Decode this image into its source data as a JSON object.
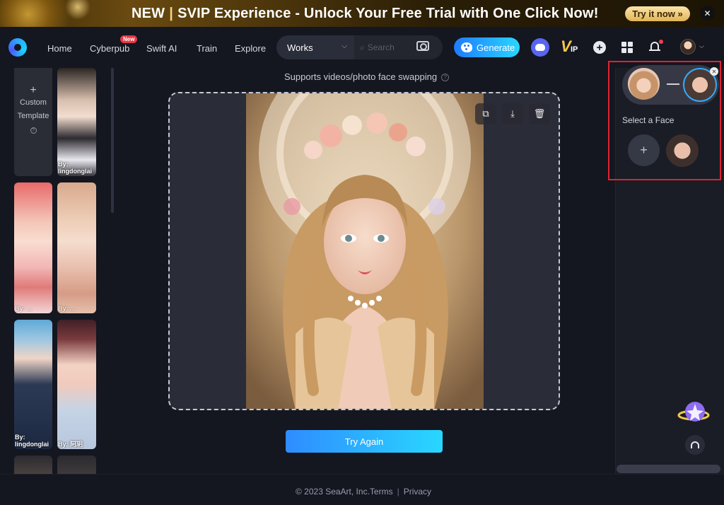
{
  "banner": {
    "new": "NEW",
    "headline": "SVIP Experience - Unlock Your Free Trial with One Click Now!",
    "cta": "Try it now",
    "cta_chevrons": "»",
    "close": "✕"
  },
  "nav": {
    "items": [
      "Home",
      "Cyberpub",
      "Swift AI",
      "Train",
      "Explore"
    ],
    "new_badge": "New",
    "works_label": "Works",
    "search_placeholder": "Search",
    "generate_label": "Generate",
    "vip_letter": "V",
    "vip_sub": "IP"
  },
  "left_panel": {
    "custom_template_line1": "Custom",
    "custom_template_line2": "Template",
    "thumbnails": [
      {
        "by": "By:\nlingdonglai"
      },
      {
        "by": "By: ..."
      },
      {
        "by": "By: ..."
      },
      {
        "by": "By:\nlingdonglai"
      },
      {
        "by": "By: 阿玥"
      }
    ]
  },
  "main": {
    "hint": "Supports videos/photo face swapping",
    "try_again": "Try Again"
  },
  "right_panel": {
    "select_face": "Select a Face"
  },
  "footer": {
    "copyright": "© 2023 SeaArt, Inc.",
    "terms": "Terms",
    "privacy": "Privacy",
    "separator": "|"
  },
  "colors": {
    "accent_start": "#1e7bff",
    "accent_end": "#29d6ff",
    "highlight": "#e0232f",
    "notification": "#ff3b4d",
    "background": "#141620"
  },
  "icons": [
    "logo-icon",
    "chevron-down-icon",
    "search-icon",
    "camera-icon",
    "palette-icon",
    "discord-icon",
    "vip-icon",
    "plus-circle-icon",
    "apps-grid-icon",
    "bell-icon",
    "user-avatar",
    "help-icon",
    "share-icon",
    "download-icon",
    "trash-icon",
    "close-icon",
    "plus-icon",
    "mascot-icon",
    "headset-icon"
  ]
}
